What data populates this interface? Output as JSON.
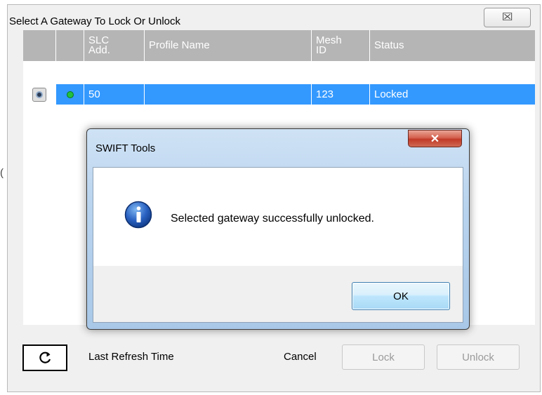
{
  "stray_glyph": "(",
  "dialog": {
    "title": "Select A Gateway To Lock Or Unlock",
    "close_glyph": "☒"
  },
  "grid": {
    "headers": [
      {
        "label": ""
      },
      {
        "label": ""
      },
      {
        "line1": "SLC",
        "line2": "Add."
      },
      {
        "label": "Profile Name"
      },
      {
        "line1": "Mesh",
        "line2": "ID"
      },
      {
        "label": "Status"
      }
    ],
    "rows": [
      {
        "slc_add": "50",
        "profile_name": "",
        "mesh_id": "123",
        "status": "Locked",
        "selected": true,
        "online": true
      }
    ]
  },
  "footer": {
    "refresh_icon": "refresh-icon",
    "last_refresh_label": "Last Refresh Time",
    "cancel_label": "Cancel",
    "lock_label": "Lock",
    "unlock_label": "Unlock"
  },
  "message_box": {
    "title": "SWIFT Tools",
    "close_glyph": "✕",
    "icon": "info-icon",
    "message": "Selected gateway successfully unlocked.",
    "ok_label": "OK"
  },
  "colors": {
    "row_selected": "#3399ff",
    "header_bg": "#b5b5b5",
    "close_red": "#c13a27",
    "status_led": "#22c040"
  }
}
